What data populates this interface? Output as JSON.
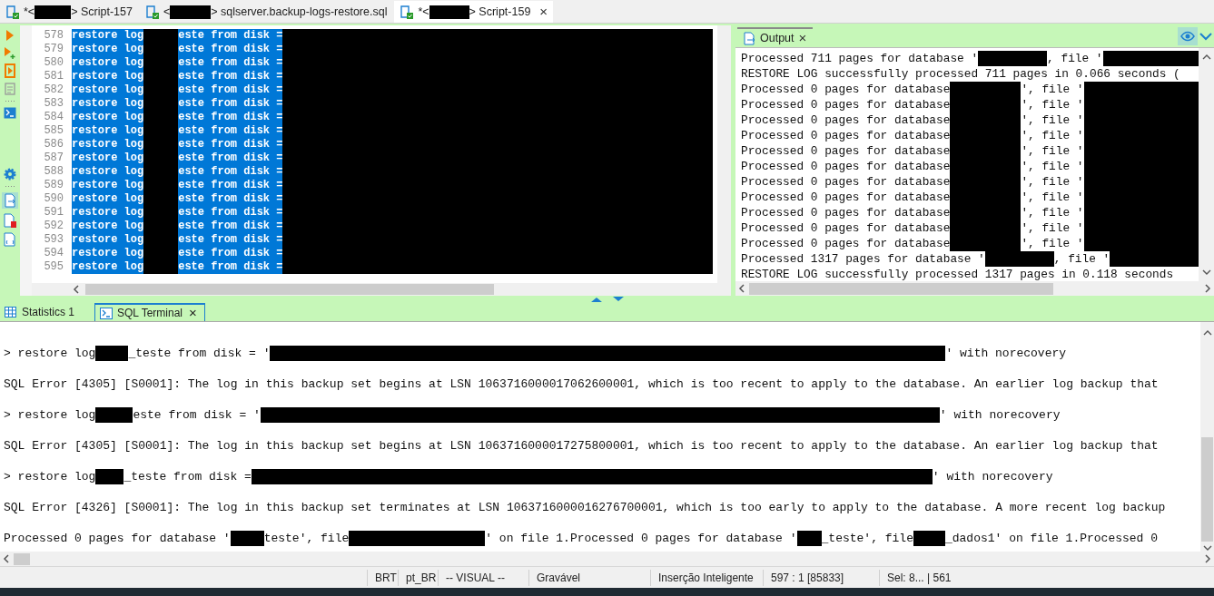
{
  "editor_tabs": [
    {
      "segments": [
        {
          "text": "*<"
        },
        {
          "kind": "redacted"
        },
        {
          "text": "> Script-157"
        }
      ],
      "selected": false
    },
    {
      "segments": [
        {
          "text": "<"
        },
        {
          "kind": "redacted"
        },
        {
          "text": "> sqlserver.backup-logs-restore.sql"
        }
      ],
      "selected": false
    },
    {
      "segments": [
        {
          "text": "*<"
        },
        {
          "kind": "redacted"
        },
        {
          "text": "> Script-159"
        }
      ],
      "selected": true,
      "close": "×"
    }
  ],
  "editor": {
    "lines": [
      {
        "number": "578",
        "segments": [
          {
            "text": "restore log"
          },
          {
            "kind": "redacted"
          },
          {
            "text": "este from disk ="
          },
          {
            "kind": "redacted"
          }
        ]
      },
      {
        "number": "579",
        "segments": [
          {
            "text": "restore log"
          },
          {
            "kind": "redacted"
          },
          {
            "text": "este from disk ="
          },
          {
            "kind": "redacted"
          }
        ]
      },
      {
        "number": "580",
        "segments": [
          {
            "text": "restore log"
          },
          {
            "kind": "redacted"
          },
          {
            "text": "este from disk ="
          },
          {
            "kind": "redacted"
          }
        ]
      },
      {
        "number": "581",
        "segments": [
          {
            "text": "restore log"
          },
          {
            "kind": "redacted"
          },
          {
            "text": "este from disk ="
          },
          {
            "kind": "redacted"
          }
        ]
      },
      {
        "number": "582",
        "segments": [
          {
            "text": "restore log"
          },
          {
            "kind": "redacted"
          },
          {
            "text": "este from disk ="
          },
          {
            "kind": "redacted"
          }
        ]
      },
      {
        "number": "583",
        "segments": [
          {
            "text": "restore log"
          },
          {
            "kind": "redacted"
          },
          {
            "text": "este from disk ="
          },
          {
            "kind": "redacted"
          }
        ]
      },
      {
        "number": "584",
        "segments": [
          {
            "text": "restore log"
          },
          {
            "kind": "redacted"
          },
          {
            "text": "este from disk ="
          },
          {
            "kind": "redacted"
          }
        ]
      },
      {
        "number": "585",
        "segments": [
          {
            "text": "restore log"
          },
          {
            "kind": "redacted"
          },
          {
            "text": "este from disk ="
          },
          {
            "kind": "redacted"
          }
        ]
      },
      {
        "number": "586",
        "segments": [
          {
            "text": "restore log"
          },
          {
            "kind": "redacted"
          },
          {
            "text": "este from disk ="
          },
          {
            "kind": "redacted"
          }
        ]
      },
      {
        "number": "587",
        "segments": [
          {
            "text": "restore log"
          },
          {
            "kind": "redacted"
          },
          {
            "text": "este from disk ="
          },
          {
            "kind": "redacted"
          }
        ]
      },
      {
        "number": "588",
        "segments": [
          {
            "text": "restore log"
          },
          {
            "kind": "redacted"
          },
          {
            "text": "este from disk ="
          },
          {
            "kind": "redacted"
          }
        ]
      },
      {
        "number": "589",
        "segments": [
          {
            "text": "restore log"
          },
          {
            "kind": "redacted"
          },
          {
            "text": "este from disk ="
          },
          {
            "kind": "redacted"
          }
        ]
      },
      {
        "number": "590",
        "segments": [
          {
            "text": "restore log"
          },
          {
            "kind": "redacted"
          },
          {
            "text": "este from disk ="
          },
          {
            "kind": "redacted"
          }
        ]
      },
      {
        "number": "591",
        "segments": [
          {
            "text": "restore log"
          },
          {
            "kind": "redacted"
          },
          {
            "text": "este from disk ="
          },
          {
            "kind": "redacted"
          }
        ]
      },
      {
        "number": "592",
        "segments": [
          {
            "text": "restore log"
          },
          {
            "kind": "redacted"
          },
          {
            "text": "este from disk ="
          },
          {
            "kind": "redacted"
          }
        ]
      },
      {
        "number": "593",
        "segments": [
          {
            "text": "restore log"
          },
          {
            "kind": "redacted"
          },
          {
            "text": "este from disk ="
          },
          {
            "kind": "redacted"
          }
        ]
      },
      {
        "number": "594",
        "segments": [
          {
            "text": "restore log"
          },
          {
            "kind": "redacted"
          },
          {
            "text": "este from disk ="
          },
          {
            "kind": "redacted"
          }
        ]
      },
      {
        "number": "595",
        "segments": [
          {
            "text": "restore log"
          },
          {
            "kind": "redacted"
          },
          {
            "text": "este from disk ="
          },
          {
            "kind": "redacted"
          }
        ]
      }
    ]
  },
  "output_panel": {
    "tab": {
      "label": "Output",
      "close": "×"
    },
    "lines": [
      {
        "segments": [
          {
            "text": "Processed 711 pages for database '"
          },
          {
            "kind": "redacted"
          },
          {
            "text": ", file '"
          },
          {
            "kind": "redacted"
          }
        ]
      },
      {
        "segments": [
          {
            "text": "RESTORE LOG successfully processed 711 pages in 0.066 seconds ("
          }
        ]
      },
      {
        "segments": [
          {
            "text": "Processed 0 pages for database"
          },
          {
            "kind": "redacted"
          },
          {
            "text": "', file '"
          },
          {
            "kind": "redacted"
          }
        ]
      },
      {
        "segments": [
          {
            "text": "Processed 0 pages for database"
          },
          {
            "kind": "redacted"
          },
          {
            "text": "', file '"
          },
          {
            "kind": "redacted"
          }
        ]
      },
      {
        "segments": [
          {
            "text": "Processed 0 pages for database"
          },
          {
            "kind": "redacted"
          },
          {
            "text": "', file '"
          },
          {
            "kind": "redacted"
          }
        ]
      },
      {
        "segments": [
          {
            "text": "Processed 0 pages for database"
          },
          {
            "kind": "redacted"
          },
          {
            "text": "', file '"
          },
          {
            "kind": "redacted"
          }
        ]
      },
      {
        "segments": [
          {
            "text": "Processed 0 pages for database"
          },
          {
            "kind": "redacted"
          },
          {
            "text": "', file '"
          },
          {
            "kind": "redacted"
          }
        ]
      },
      {
        "segments": [
          {
            "text": "Processed 0 pages for database"
          },
          {
            "kind": "redacted"
          },
          {
            "text": "', file '"
          },
          {
            "kind": "redacted"
          }
        ]
      },
      {
        "segments": [
          {
            "text": "Processed 0 pages for database"
          },
          {
            "kind": "redacted"
          },
          {
            "text": "', file '"
          },
          {
            "kind": "redacted"
          }
        ]
      },
      {
        "segments": [
          {
            "text": "Processed 0 pages for database"
          },
          {
            "kind": "redacted"
          },
          {
            "text": "', file '"
          },
          {
            "kind": "redacted"
          }
        ]
      },
      {
        "segments": [
          {
            "text": "Processed 0 pages for database"
          },
          {
            "kind": "redacted"
          },
          {
            "text": "', file '"
          },
          {
            "kind": "redacted"
          }
        ]
      },
      {
        "segments": [
          {
            "text": "Processed 0 pages for database"
          },
          {
            "kind": "redacted"
          },
          {
            "text": "', file '"
          },
          {
            "kind": "redacted"
          }
        ]
      },
      {
        "segments": [
          {
            "text": "Processed 0 pages for database"
          },
          {
            "kind": "redacted"
          },
          {
            "text": "', file '"
          },
          {
            "kind": "redacted"
          }
        ]
      },
      {
        "segments": [
          {
            "text": "Processed 1317 pages for database '"
          },
          {
            "kind": "redacted"
          },
          {
            "text": ", file '"
          },
          {
            "kind": "redacted"
          }
        ]
      },
      {
        "segments": [
          {
            "text": "RESTORE LOG successfully processed 1317 pages in 0.118 seconds"
          }
        ]
      }
    ]
  },
  "bottom_tabs": [
    {
      "label": "Statistics 1",
      "selected": false
    },
    {
      "label": "SQL Terminal",
      "selected": true,
      "close": "×"
    }
  ],
  "terminal": {
    "lines": [
      {
        "segments": [
          {
            "text": "> restore log"
          },
          {
            "kind": "redacted"
          },
          {
            "text": "_teste from disk = '"
          },
          {
            "kind": "redacted"
          },
          {
            "text": "' with norecovery"
          }
        ]
      },
      {
        "segments": [
          {
            "text": "SQL Error [4305] [S0001]: The log in this backup set begins at LSN 1063716000017062600001, which is too recent to apply to the database. An earlier log backup that"
          }
        ]
      },
      {
        "segments": [
          {
            "text": "> restore log"
          },
          {
            "kind": "redacted"
          },
          {
            "text": "este from disk = '"
          },
          {
            "kind": "redacted"
          },
          {
            "text": "' with norecovery"
          }
        ]
      },
      {
        "segments": [
          {
            "text": "SQL Error [4305] [S0001]: The log in this backup set begins at LSN 1063716000017275800001, which is too recent to apply to the database. An earlier log backup that"
          }
        ]
      },
      {
        "segments": [
          {
            "text": "> restore log"
          },
          {
            "kind": "redacted"
          },
          {
            "text": "_teste from disk ="
          },
          {
            "kind": "redacted"
          },
          {
            "text": "' with norecovery"
          }
        ]
      },
      {
        "segments": [
          {
            "text": "SQL Error [4326] [S0001]: The log in this backup set terminates at LSN 1063716000016276700001, which is too early to apply to the database. A more recent log backup"
          }
        ]
      },
      {
        "segments": [
          {
            "text": "Processed 0 pages for database '"
          },
          {
            "kind": "redacted"
          },
          {
            "text": "teste', file"
          },
          {
            "kind": "redacted"
          },
          {
            "text": "' on file 1.Processed 0 pages for database '"
          },
          {
            "kind": "redacted"
          },
          {
            "text": "_teste', file"
          },
          {
            "kind": "redacted"
          },
          {
            "text": "_dados1' on file 1.Processed 0"
          }
        ]
      }
    ]
  },
  "status_bar": [
    "BRT",
    "pt_BR",
    "-- VISUAL --",
    "Gravável",
    "Inserção Inteligente",
    "597 : 1 [85833]",
    "Sel: 8... | 561"
  ]
}
